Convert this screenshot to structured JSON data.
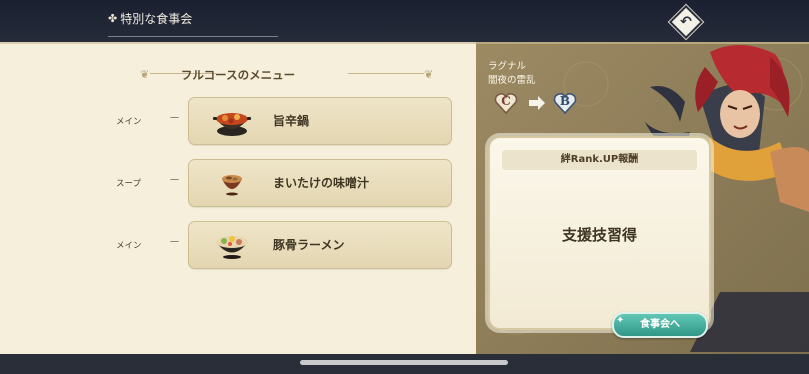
{
  "header": {
    "title": "特別な食事会",
    "back_icon": "return-arrow-icon"
  },
  "menu": {
    "heading": "フルコースのメニュー",
    "items": [
      {
        "category": "メイン",
        "dash": "—",
        "name": "旨辛鍋",
        "icon": "spicy-hotpot-icon"
      },
      {
        "category": "スープ",
        "dash": "—",
        "name": "まいたけの味噌汁",
        "icon": "miso-soup-icon"
      },
      {
        "category": "メイン",
        "dash": "—",
        "name": "豚骨ラーメン",
        "icon": "tonkotsu-ramen-icon"
      }
    ]
  },
  "character": {
    "name": "ラグナル",
    "title": "闇夜の雷乱",
    "rank_from": "C",
    "rank_to": "B"
  },
  "reward": {
    "header": "絆Rank.UP報酬",
    "body": "支援技習得"
  },
  "actions": {
    "go_meal_label": "食事会へ"
  },
  "colors": {
    "accent_teal": "#3fae9c",
    "panel_cream": "#f5efdb",
    "panel_tan": "#8f7f5b",
    "topbar_navy": "#1d2232"
  }
}
